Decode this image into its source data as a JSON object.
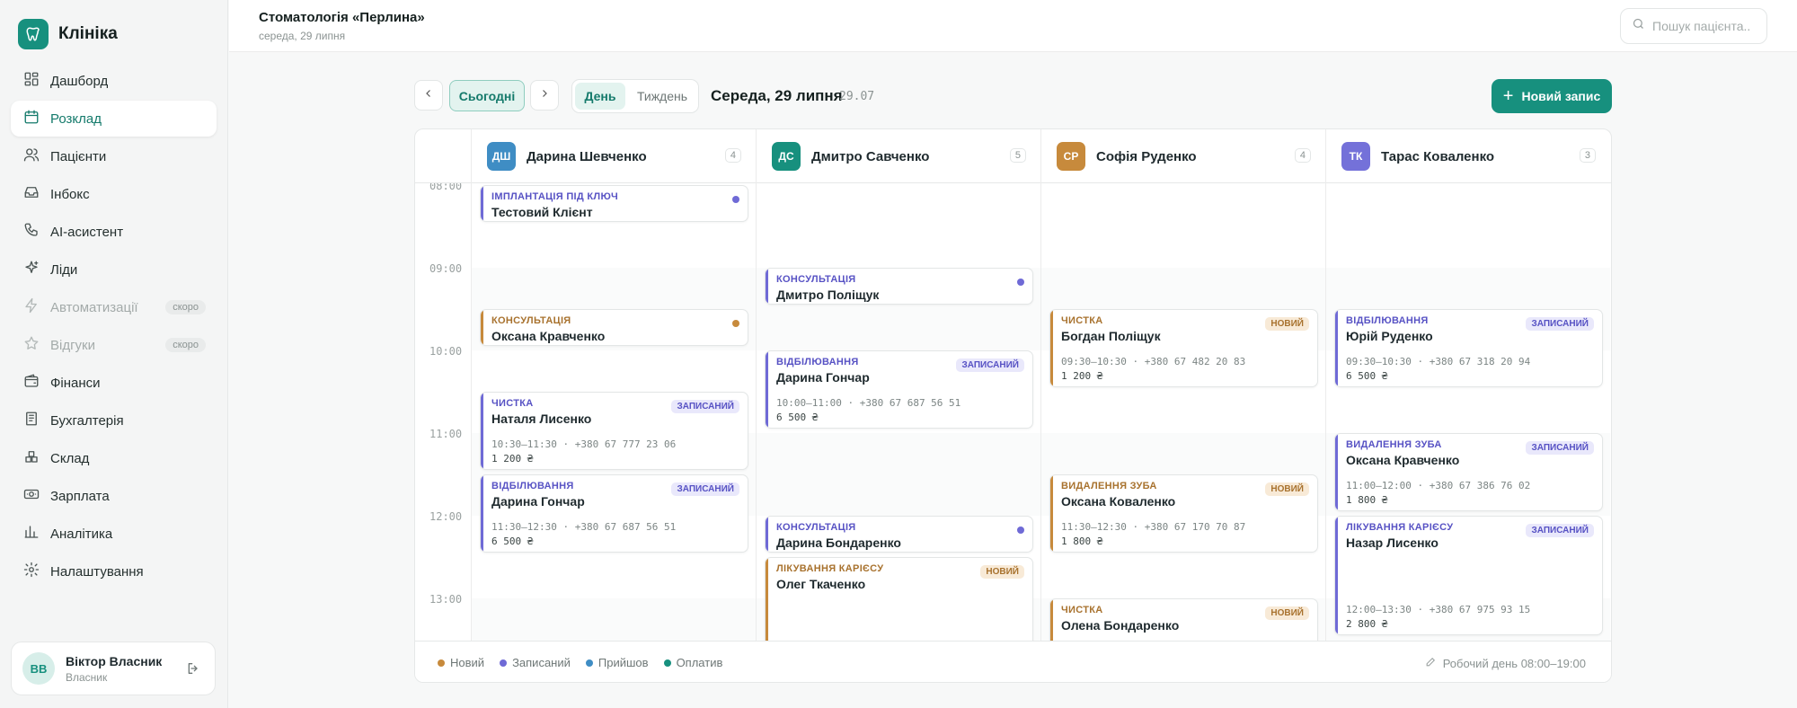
{
  "app": {
    "name": "Клініка"
  },
  "sidebar": {
    "items": [
      {
        "label": "Дашборд",
        "icon": "dashboard-icon"
      },
      {
        "label": "Розклад",
        "icon": "calendar-icon",
        "active": true
      },
      {
        "label": "Пацієнти",
        "icon": "users-icon"
      },
      {
        "label": "Інбокс",
        "icon": "inbox-icon"
      },
      {
        "label": "AI-асистент",
        "icon": "phone-icon"
      },
      {
        "label": "Ліди",
        "icon": "sparkles-icon"
      },
      {
        "label": "Автоматизації",
        "icon": "lightning-icon",
        "badge": "скоро",
        "disabled": true
      },
      {
        "label": "Відгуки",
        "icon": "star-icon",
        "badge": "скоро",
        "disabled": true
      },
      {
        "label": "Фінанси",
        "icon": "wallet-icon"
      },
      {
        "label": "Бухгалтерія",
        "icon": "ledger-icon"
      },
      {
        "label": "Склад",
        "icon": "boxes-icon"
      },
      {
        "label": "Зарплата",
        "icon": "cash-icon"
      },
      {
        "label": "Аналітика",
        "icon": "bar-chart-icon"
      },
      {
        "label": "Налаштування",
        "icon": "gear-icon"
      }
    ]
  },
  "user": {
    "initials": "ВВ",
    "name": "Віктор Власник",
    "role": "Власник"
  },
  "header": {
    "clinic": "Стоматологія «Перлина»",
    "date": "середа, 29 липня",
    "search_placeholder": "Пошук пацієнта..."
  },
  "toolbar": {
    "today": "Сьогодні",
    "view_day": "День",
    "view_week": "Тиждень",
    "date_title": "Середа, 29 липня",
    "date_short": "29.07",
    "new_appointment": "Новий запис"
  },
  "times": [
    "08:00",
    "09:00",
    "10:00",
    "11:00",
    "12:00",
    "13:00"
  ],
  "doctors": [
    {
      "initials": "ДШ",
      "name": "Дарина Шевченко",
      "count": "4",
      "color": "#3f8dc4"
    },
    {
      "initials": "ДС",
      "name": "Дмитро Савченко",
      "count": "5",
      "color": "#17907e"
    },
    {
      "initials": "СР",
      "name": "Софія Руденко",
      "count": "4",
      "color": "#c78a3c"
    },
    {
      "initials": "ТК",
      "name": "Тарас Коваленко",
      "count": "3",
      "color": "#7471d9"
    }
  ],
  "appointments": [
    [
      {
        "type": "ІМПЛАНТАЦІЯ ПІД КЛЮЧ",
        "name": "Тестовий Клієнт",
        "status": "booked"
      },
      {
        "type": "КОНСУЛЬТАЦІЯ",
        "name": "Оксана Кравченко",
        "status": "new"
      },
      {
        "type": "ЧИСТКА",
        "name": "Наталя Лисенко",
        "status": "booked",
        "badge": "ЗАПИСАНИЙ",
        "time": "10:30–11:30 · +380 67 777 23 06",
        "price": "1 200 ₴"
      },
      {
        "type": "ВІДБІЛЮВАННЯ",
        "name": "Дарина Гончар",
        "status": "booked",
        "badge": "ЗАПИСАНИЙ",
        "time": "11:30–12:30 · +380 67 687 56 51",
        "price": "6 500 ₴"
      }
    ],
    [
      {
        "type": "КОНСУЛЬТАЦІЯ",
        "name": "Дмитро Поліщук",
        "status": "booked"
      },
      {
        "type": "ВІДБІЛЮВАННЯ",
        "name": "Дарина Гончар",
        "status": "booked",
        "badge": "ЗАПИСАНИЙ",
        "time": "10:00–11:00 · +380 67 687 56 51",
        "price": "6 500 ₴"
      },
      {
        "type": "КОНСУЛЬТАЦІЯ",
        "name": "Дарина Бондаренко",
        "status": "booked"
      },
      {
        "type": "ЛІКУВАННЯ КАРІЄСУ",
        "name": "Олег Ткаченко",
        "status": "new",
        "badge": "НОВИЙ"
      }
    ],
    [
      {
        "type": "ЧИСТКА",
        "name": "Богдан Поліщук",
        "status": "new",
        "badge": "НОВИЙ",
        "time": "09:30–10:30 · +380 67 482 20 83",
        "price": "1 200 ₴"
      },
      {
        "type": "ВИДАЛЕННЯ ЗУБА",
        "name": "Оксана Коваленко",
        "status": "new",
        "badge": "НОВИЙ",
        "time": "11:30–12:30 · +380 67 170 70 87",
        "price": "1 800 ₴"
      },
      {
        "type": "ЧИСТКА",
        "name": "Олена Бондаренко",
        "status": "new",
        "badge": "НОВИЙ"
      }
    ],
    [
      {
        "type": "ВІДБІЛЮВАННЯ",
        "name": "Юрій Руденко",
        "status": "booked",
        "badge": "ЗАПИСАНИЙ",
        "time": "09:30–10:30 · +380 67 318 20 94",
        "price": "6 500 ₴"
      },
      {
        "type": "ВИДАЛЕННЯ ЗУБА",
        "name": "Оксана Кравченко",
        "status": "booked",
        "badge": "ЗАПИСАНИЙ",
        "time": "11:00–12:00 · +380 67 386 76 02",
        "price": "1 800 ₴"
      },
      {
        "type": "ЛІКУВАННЯ КАРІЄСУ",
        "name": "Назар Лисенко",
        "status": "booked",
        "badge": "ЗАПИСАНИЙ",
        "time": "12:00–13:30 · +380 67 975 93 15",
        "price": "2 800 ₴"
      }
    ]
  ],
  "legend": [
    {
      "label": "Новий",
      "color": "#c78a3c"
    },
    {
      "label": "Записаний",
      "color": "#6f6ad6"
    },
    {
      "label": "Прийшов",
      "color": "#3f8dc4"
    },
    {
      "label": "Оплатив",
      "color": "#17907e"
    }
  ],
  "footer": {
    "workday": "Робочий день 08:00–19:00"
  }
}
